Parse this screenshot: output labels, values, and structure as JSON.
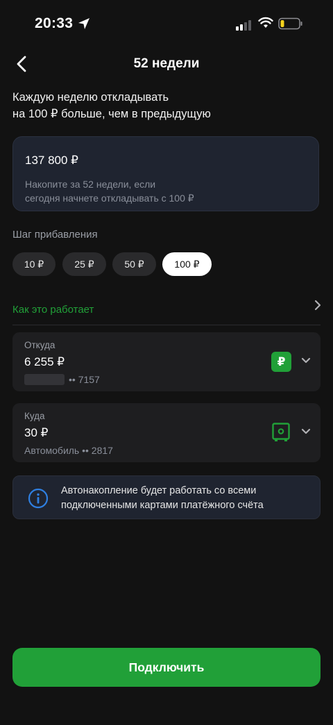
{
  "status_bar": {
    "time": "20:33"
  },
  "header": {
    "title": "52 недели"
  },
  "intro": {
    "line1": "Каждую неделю откладывать",
    "line2": "на 100 ₽ больше, чем в предыдущую"
  },
  "summary": {
    "amount": "137 800 ₽",
    "desc_line1": "Накопите за 52 недели, если",
    "desc_line2": "сегодня начнете откладывать с 100 ₽"
  },
  "step": {
    "label": "Шаг прибавления",
    "options": [
      "10 ₽",
      "25 ₽",
      "50 ₽",
      "100 ₽"
    ],
    "selected": "100 ₽"
  },
  "how_it_works": {
    "label": "Как это работает"
  },
  "from_account": {
    "label": "Откуда",
    "amount": "6 255 ₽",
    "masked_number": "•• 7157",
    "badge": "₽"
  },
  "to_account": {
    "label": "Куда",
    "amount": "30 ₽",
    "name": "Автомобиль •• 2817"
  },
  "info": {
    "line1": "Автонакопление будет работать со всеми",
    "line2": "подключенными картами платёжного счёта"
  },
  "actions": {
    "connect_label": "Подключить"
  },
  "colors": {
    "accent": "#21a038",
    "background": "#121212",
    "info_icon": "#2f7fe0"
  }
}
